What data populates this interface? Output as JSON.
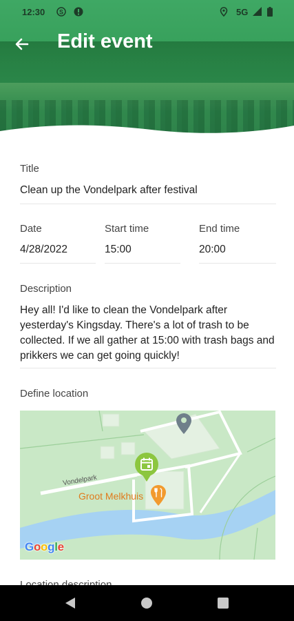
{
  "status_bar": {
    "time": "12:30",
    "network": "5G",
    "icons": [
      "sim-s-icon",
      "notification-dot-icon",
      "location-icon",
      "signal-icon",
      "battery-icon"
    ]
  },
  "header": {
    "title": "Edit event",
    "back_icon": "arrow-left-icon",
    "brand_color": "#37a05b"
  },
  "form": {
    "title": {
      "label": "Title",
      "value": "Clean up the Vondelpark after festival"
    },
    "date": {
      "label": "Date",
      "value": "4/28/2022"
    },
    "start_time": {
      "label": "Start time",
      "value": "15:00"
    },
    "end_time": {
      "label": "End time",
      "value": "20:00"
    },
    "description": {
      "label": "Description",
      "value": "Hey all! I'd like to clean the Vondelpark after yesterday's Kingsday. There's a lot of trash to be collected. If we all gather at 15:00 with trash bags and prikkers we can get going quickly!"
    },
    "location": {
      "label": "Define location",
      "map": {
        "street_label": "Vondelpark",
        "poi_label": "Groot Melkhuis",
        "logo_text": "Google",
        "marker_color": "#8cc63f",
        "poi_color": "#f29a2e"
      }
    },
    "location_description": {
      "label": "Location description"
    }
  },
  "nav_bar": {
    "icons": [
      "back-triangle-icon",
      "home-circle-icon",
      "recents-square-icon"
    ]
  }
}
